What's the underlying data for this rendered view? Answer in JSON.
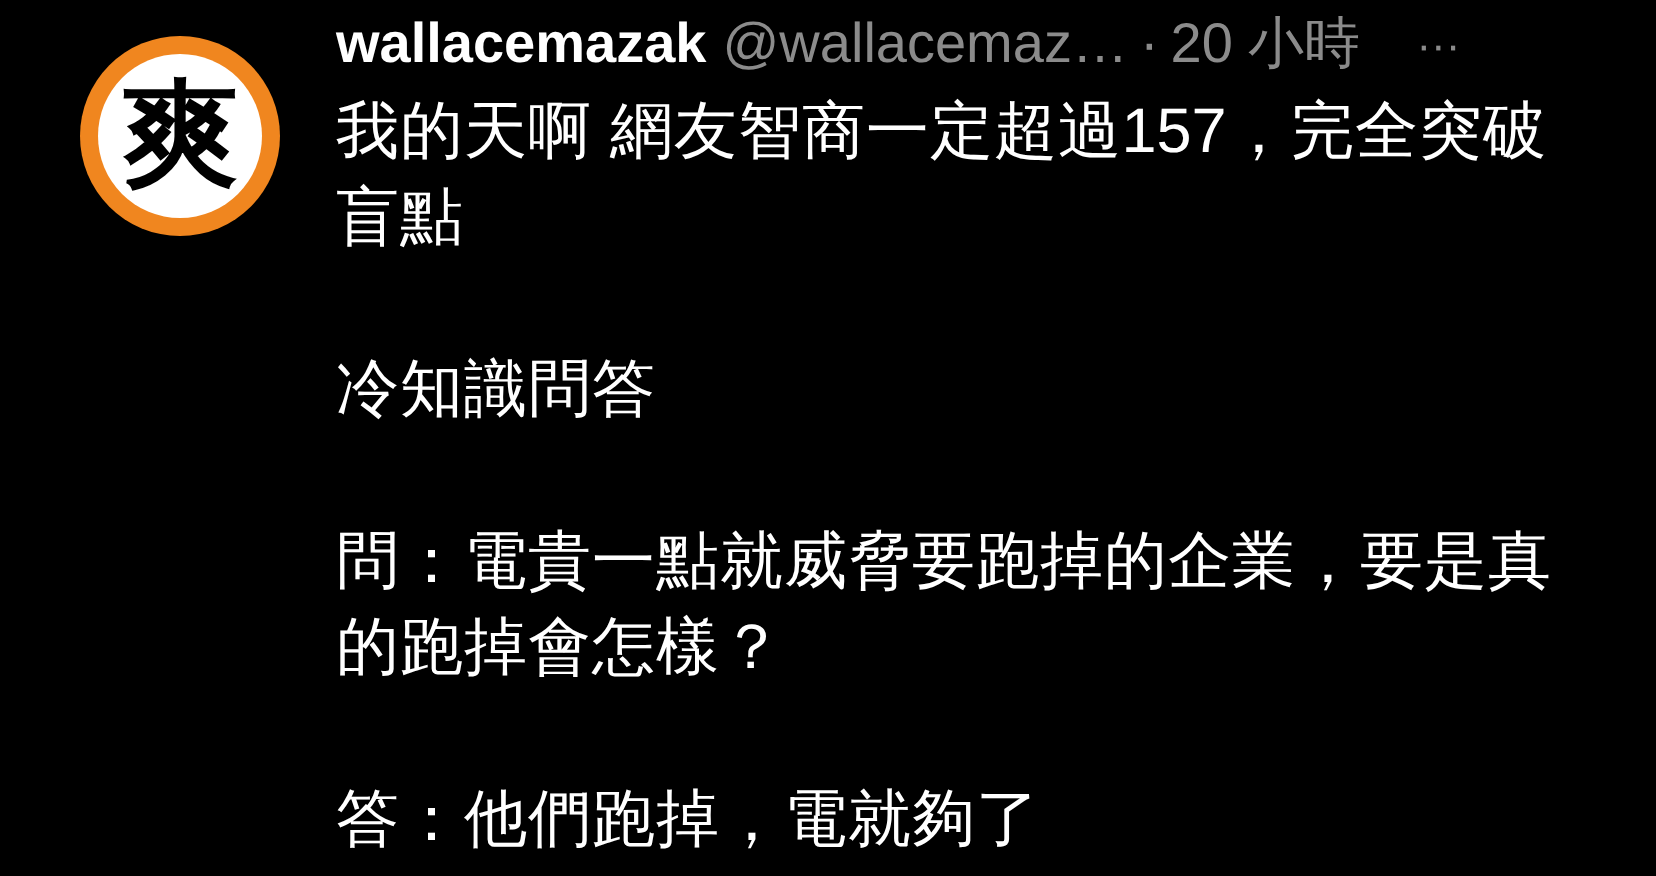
{
  "post": {
    "avatar_glyph": "爽",
    "display_name": "wallacemazak",
    "handle": "@wallacemaz…",
    "separator": "·",
    "time": "20 小時",
    "more": "···",
    "paragraphs": [
      "我的天啊 網友智商一定超過157，完全突破盲點",
      "冷知識問答",
      "問：電貴一點就威脅要跑掉的企業，要是真的跑掉會怎樣？",
      "答：他們跑掉，電就夠了"
    ]
  }
}
